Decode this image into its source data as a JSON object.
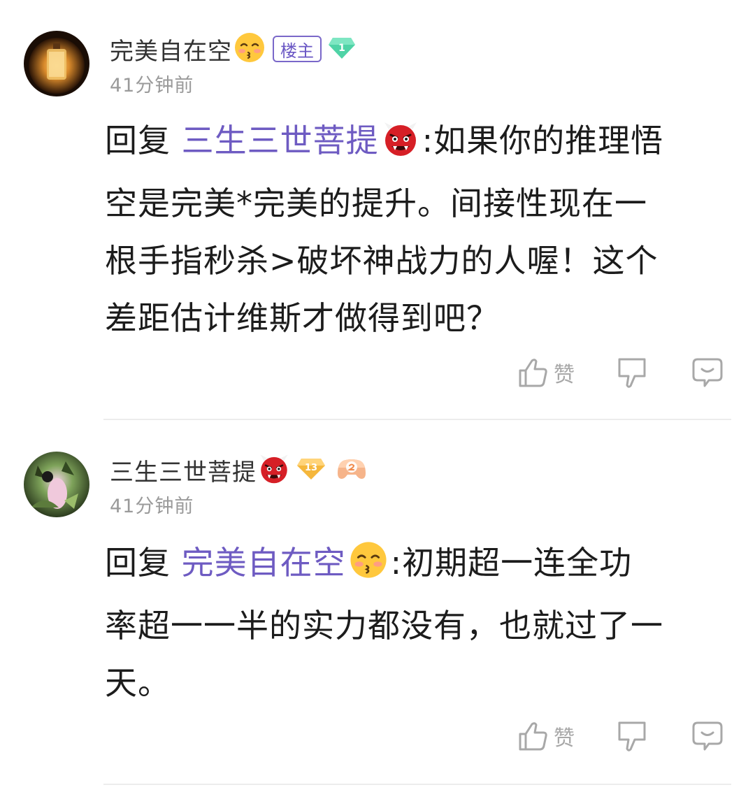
{
  "comments": [
    {
      "username": "完美自在空",
      "owner_badge": "楼主",
      "level": "1",
      "time": "41分钟前",
      "reply_label": "回复",
      "reply_target": "三生三世菩提",
      "content_lines": [
        ":如果你的推理悟",
        "空是完美*完美的提升。间接性现在一",
        "根手指秒杀>破坏神战力的人喔！这个",
        "差距估计维斯才做得到吧？"
      ],
      "like_label": "赞"
    },
    {
      "username": "三生三世菩提",
      "level": "13",
      "time": "41分钟前",
      "reply_label": "回复",
      "reply_target": "完美自在空",
      "content_lines": [
        ":初期超一连全功",
        "率超一一半的实力都没有，也就过了一",
        "天。"
      ],
      "like_label": "赞"
    }
  ],
  "colors": {
    "accent": "#6e5bc2",
    "meta": "#9a9a9a",
    "icon": "#a8a8a8",
    "level_green": "#4fd3a6",
    "level_gold": "#f5b73c"
  }
}
